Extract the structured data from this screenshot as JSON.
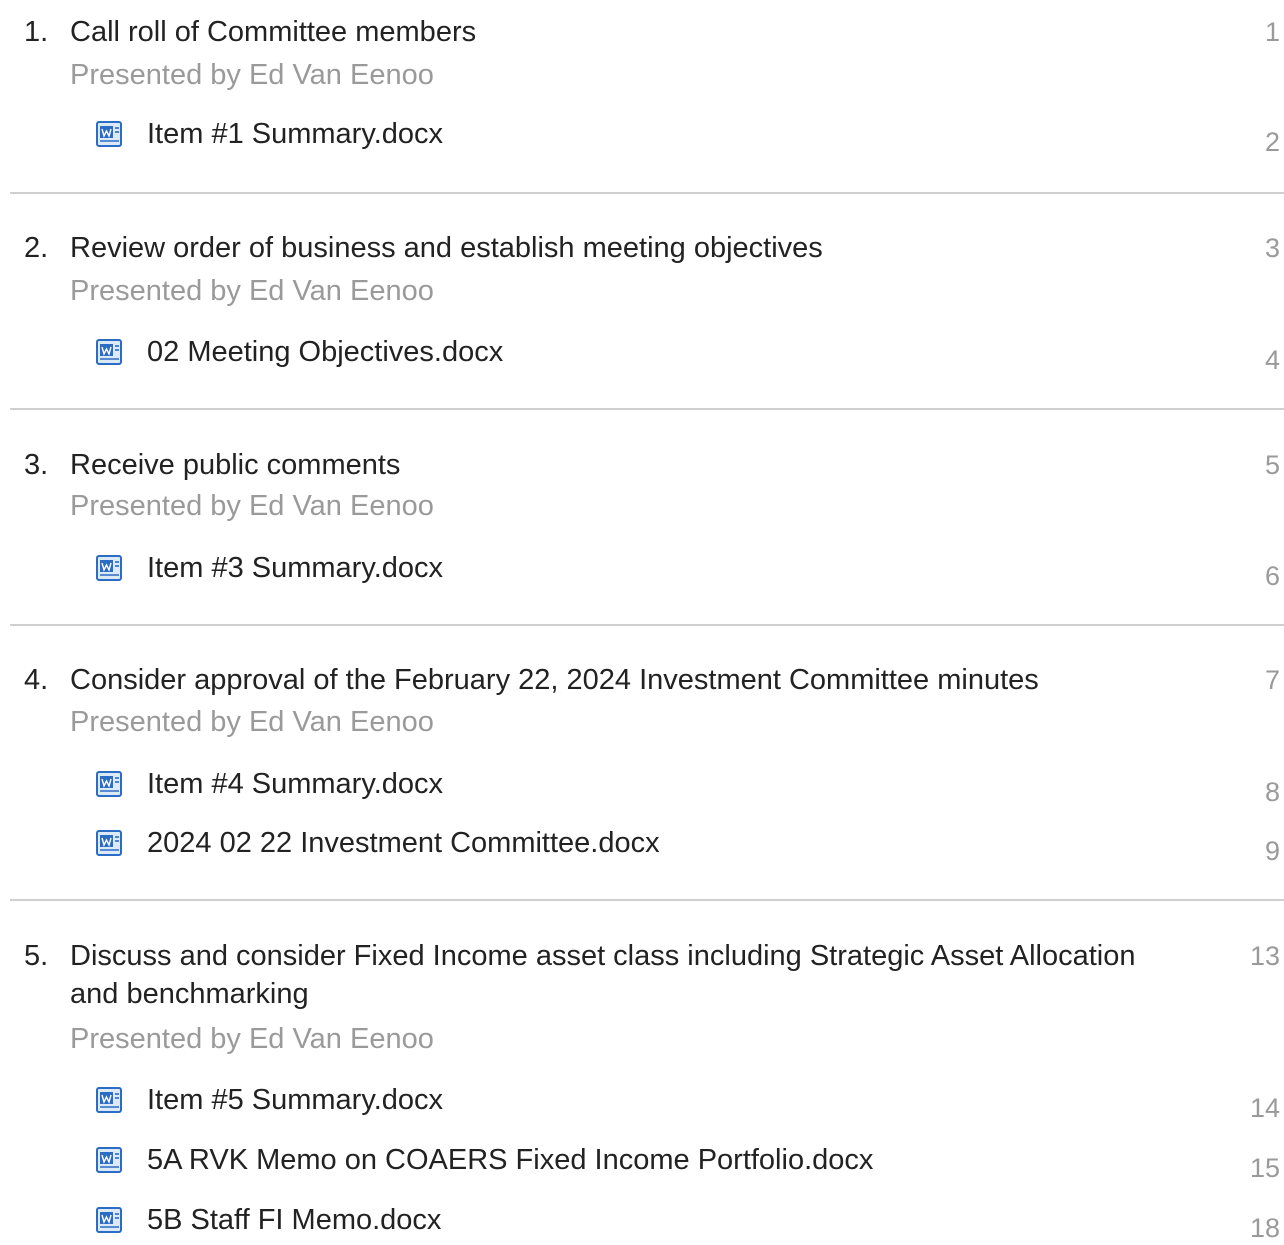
{
  "agenda": [
    {
      "number": "1.",
      "title": "Call roll of Committee members",
      "presenter": "Presented by Ed Van Eenoo",
      "page": "1",
      "attachments": [
        {
          "name": "Item #1 Summary.docx",
          "page": "2",
          "icon": "word-document-icon"
        }
      ]
    },
    {
      "number": "2.",
      "title": "Review order of business and establish meeting objectives",
      "presenter": "Presented by Ed Van Eenoo",
      "page": "3",
      "attachments": [
        {
          "name": "02 Meeting Objectives.docx",
          "page": "4",
          "icon": "word-document-icon"
        }
      ]
    },
    {
      "number": "3.",
      "title": "Receive public comments",
      "presenter": "Presented by Ed Van Eenoo",
      "page": "5",
      "attachments": [
        {
          "name": "Item #3 Summary.docx",
          "page": "6",
          "icon": "word-document-icon"
        }
      ]
    },
    {
      "number": "4.",
      "title": "Consider approval of the February 22, 2024 Investment Committee minutes",
      "presenter": "Presented by Ed Van Eenoo",
      "page": "7",
      "attachments": [
        {
          "name": "Item #4 Summary.docx",
          "page": "8",
          "icon": "word-document-icon"
        },
        {
          "name": "2024 02 22 Investment Committee.docx",
          "page": "9",
          "icon": "word-document-icon"
        }
      ]
    },
    {
      "number": "5.",
      "title": "Discuss and consider Fixed Income asset class including Strategic Asset Allocation and benchmarking",
      "presenter": "Presented by Ed Van Eenoo",
      "page": "13",
      "attachments": [
        {
          "name": "Item #5 Summary.docx",
          "page": "14",
          "icon": "word-document-icon"
        },
        {
          "name": "5A RVK Memo on COAERS Fixed Income Portfolio.docx",
          "page": "15",
          "icon": "word-document-icon"
        },
        {
          "name": "5B Staff FI Memo.docx",
          "page": "18",
          "icon": "word-document-icon"
        }
      ]
    }
  ],
  "colors": {
    "text": "#222222",
    "muted": "#9a9a9a",
    "divider": "#cfcfcf",
    "icon_blue": "#2b6cc4",
    "icon_light": "#dce9f8"
  }
}
